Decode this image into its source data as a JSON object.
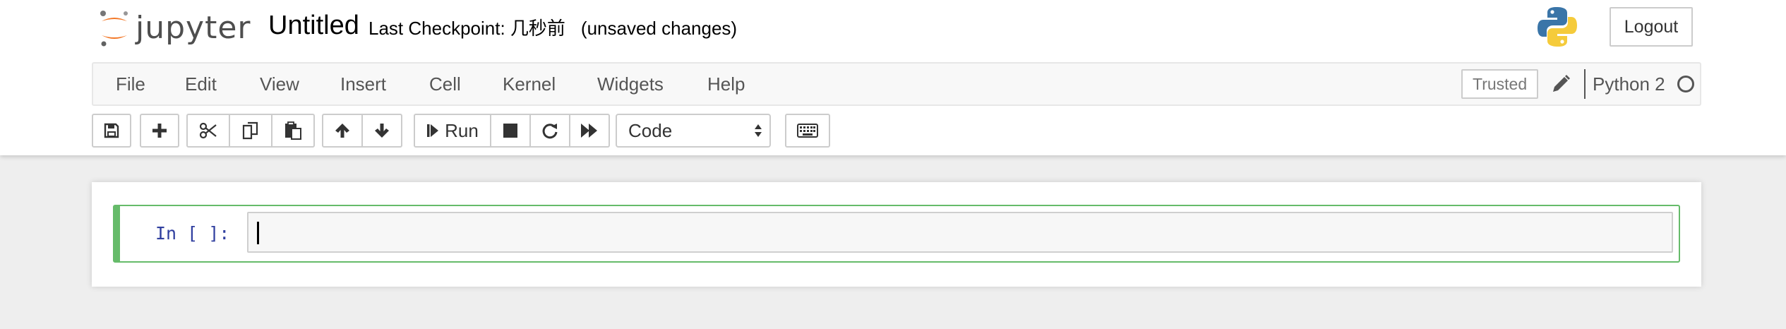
{
  "header": {
    "logo_text": "jupyter",
    "notebook_name": "Untitled",
    "checkpoint_label": "Last Checkpoint:",
    "checkpoint_time": "几秒前",
    "save_status": "(unsaved changes)",
    "logout_label": "Logout"
  },
  "menubar": {
    "items": [
      {
        "label": "File"
      },
      {
        "label": "Edit"
      },
      {
        "label": "View"
      },
      {
        "label": "Insert"
      },
      {
        "label": "Cell"
      },
      {
        "label": "Kernel"
      },
      {
        "label": "Widgets"
      },
      {
        "label": "Help"
      }
    ],
    "trusted_label": "Trusted",
    "kernel_name": "Python 2"
  },
  "toolbar": {
    "run_label": "Run",
    "cell_type_value": "Code",
    "icons": [
      "save-icon",
      "plus-icon",
      "cut-icon",
      "copy-icon",
      "paste-icon",
      "arrow-up-icon",
      "arrow-down-icon",
      "step-forward-icon",
      "stop-icon",
      "restart-icon",
      "fast-forward-icon",
      "keyboard-icon"
    ]
  },
  "cell": {
    "prompt": "In [ ]:",
    "source": ""
  },
  "colors": {
    "cell_selected_border": "#66bb6a",
    "prompt_color": "#303f9f",
    "page_background": "#eeeeee"
  }
}
